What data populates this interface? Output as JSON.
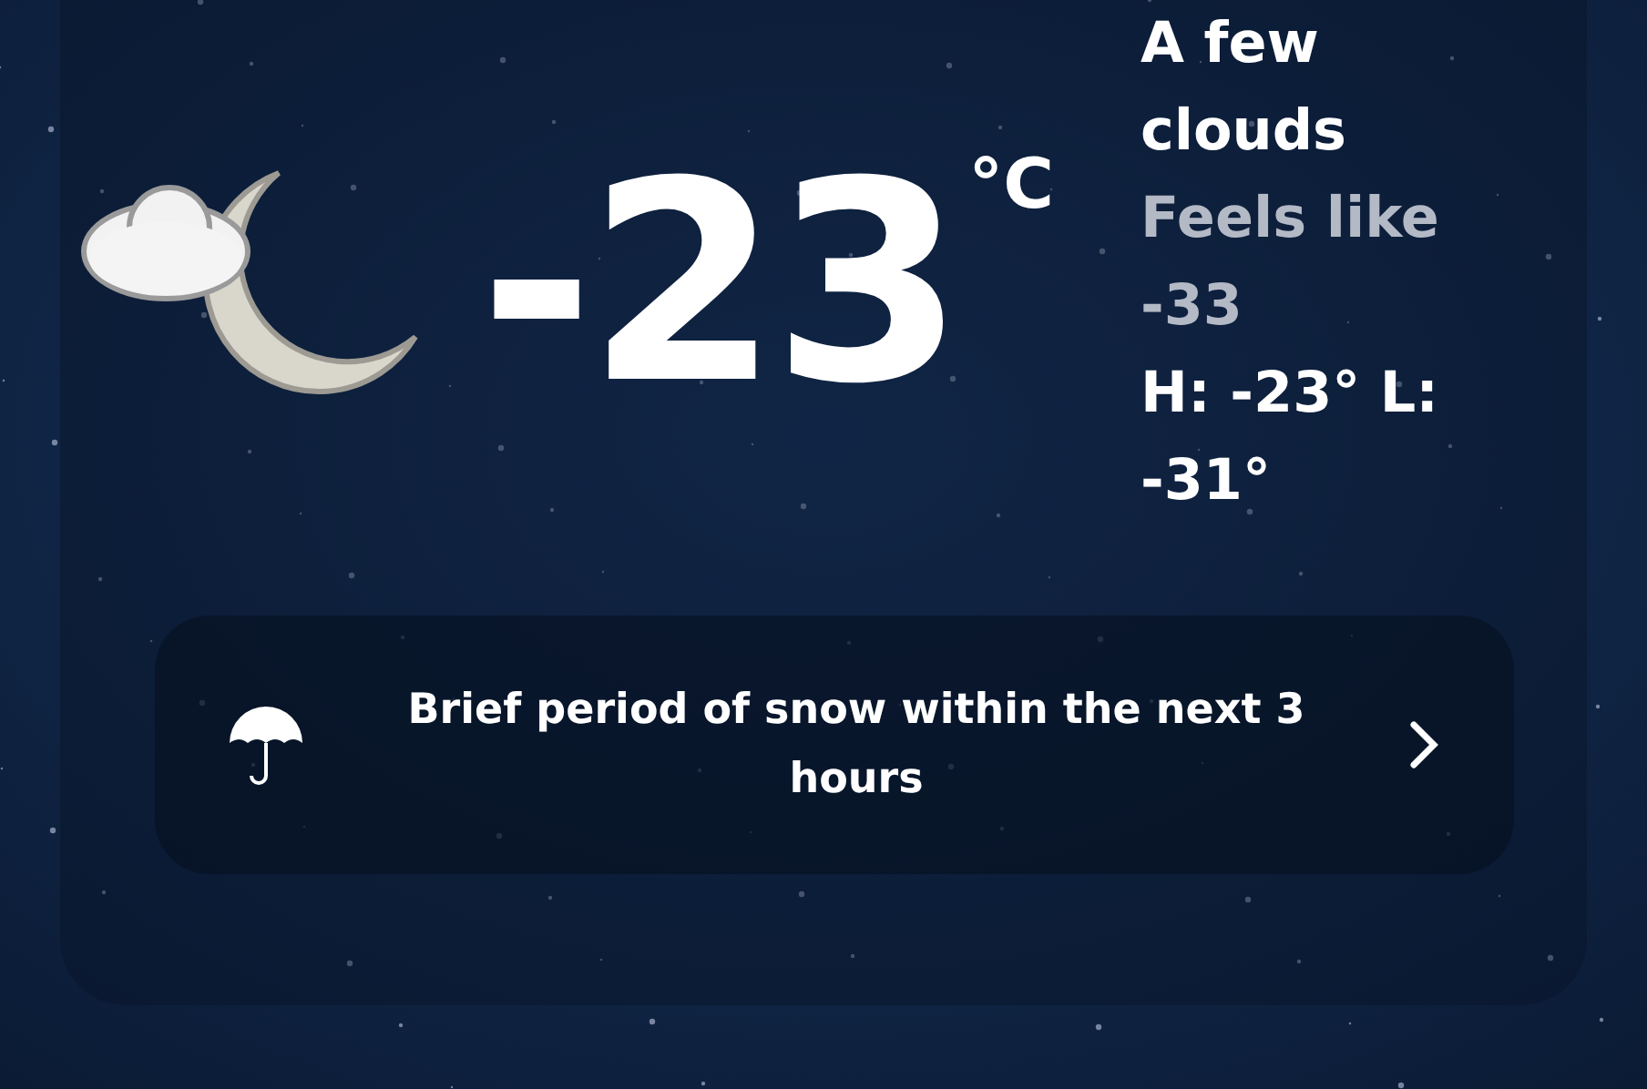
{
  "current": {
    "temperature": "-23",
    "unit": "°C",
    "condition": "A few clouds",
    "feels_like": "Feels like -33",
    "high_low": "H: -23° L: -31°"
  },
  "alert": {
    "text": "Brief period of snow within the next 3 hours"
  }
}
